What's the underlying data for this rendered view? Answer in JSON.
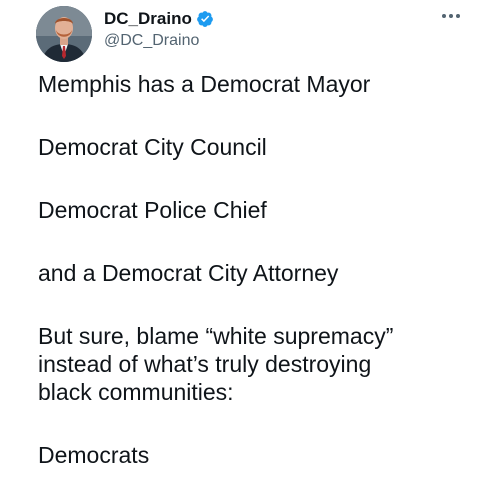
{
  "author": {
    "display_name": "DC_Draino",
    "handle": "@DC_Draino",
    "verified": true,
    "avatar_icon": "profile-photo-icon"
  },
  "tweet": {
    "paragraphs": [
      "Memphis has a Democrat Mayor",
      "Democrat City Council",
      "Democrat Police Chief",
      "and a Democrat City Attorney",
      "But sure, blame “white supremacy”\ninstead of what’s truly destroying\nblack communities:",
      "Democrats"
    ]
  },
  "colors": {
    "verified_badge": "#1d9bf0",
    "text_primary": "#0f1419",
    "text_secondary": "#536471"
  }
}
